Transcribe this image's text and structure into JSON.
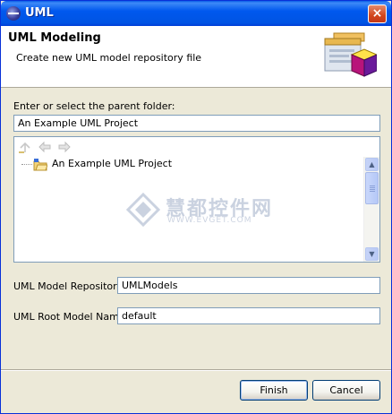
{
  "window": {
    "title": "UML",
    "close_glyph": "×"
  },
  "header": {
    "title": "UML Modeling",
    "description": "Create new UML model repository file"
  },
  "parent_folder": {
    "label": "Enter or select the parent folder:",
    "value": "An Example UML Project"
  },
  "tree": {
    "toolbar_icons": [
      "go-up-icon",
      "back-arrow-icon",
      "forward-arrow-icon"
    ],
    "items": [
      {
        "label": "An Example UML Project",
        "icon": "project-folder-icon"
      }
    ]
  },
  "watermark": {
    "text": "慧都控件网",
    "sub": "WWW.EVGET.COM"
  },
  "repository": {
    "label": "UML Model Repository:",
    "value": "UMLModels"
  },
  "root_model": {
    "label": "UML Root Model Name:",
    "value": "default"
  },
  "buttons": {
    "finish": "Finish",
    "cancel": "Cancel"
  },
  "colors": {
    "titlebar": "#0054e3",
    "selection": "#ffffff",
    "dialog_bg": "#ece9d8"
  }
}
